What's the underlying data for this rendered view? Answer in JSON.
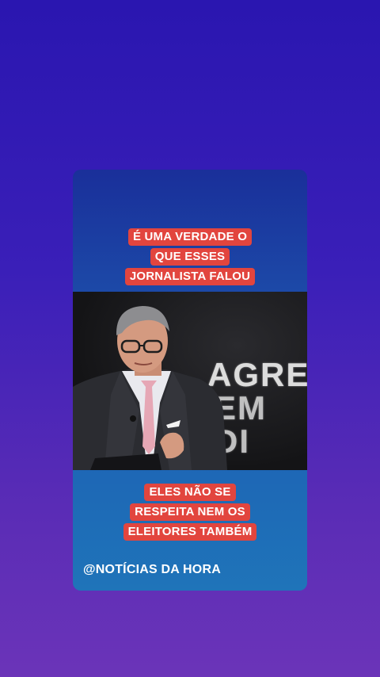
{
  "card": {
    "top_caption": [
      "É UMA VERDADE O",
      "QUE ESSES",
      "JORNALISTA FALOU"
    ],
    "bottom_caption": [
      "ELES NÃO SE",
      "RESPEITA NEM OS",
      "ELEITORES TAMBÉM"
    ],
    "watermark": "@NOTÍCIAS DA HORA"
  },
  "video": {
    "background_text_line1": "AGRE",
    "background_text_line2": "EM DI"
  },
  "colors": {
    "caption_bg": "#e2453e",
    "page_gradient_top": "#2a16b0",
    "page_gradient_bottom": "#6b34b8"
  }
}
